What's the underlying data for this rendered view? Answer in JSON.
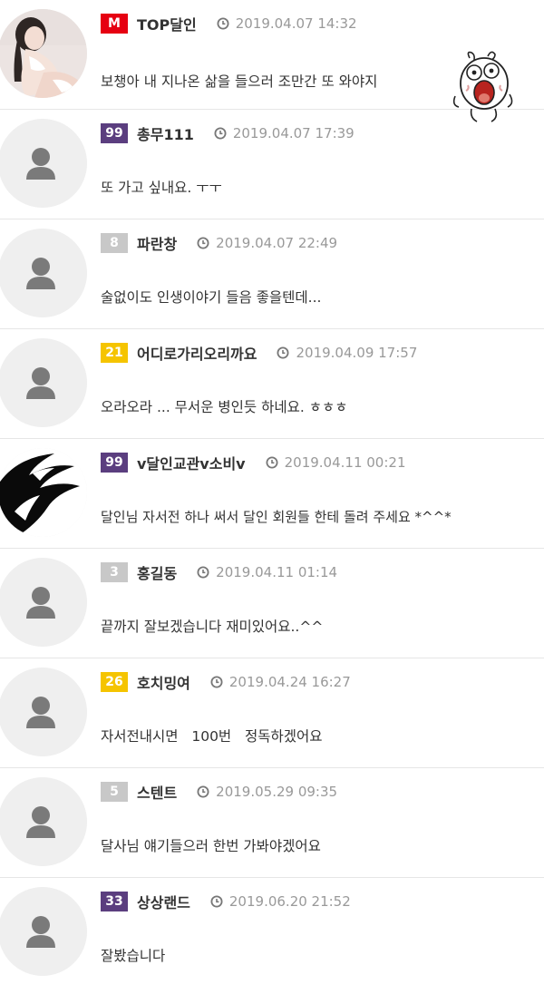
{
  "comments": [
    {
      "avatar": "user-photo",
      "level": "M",
      "level_color": "#e60012",
      "nickname": "TOP달인",
      "date": "2019.04.07 14:32",
      "content": "보챙아 내 지나온 삶을 들으러 조만간 또 와야지",
      "emoticon": "surprised-cartoon-face"
    },
    {
      "avatar": "default-person",
      "level": "99",
      "level_color": "#5b3e7f",
      "nickname": "총무111",
      "date": "2019.04.07 17:39",
      "content": "또 가고 싶내요. ㅜㅜ"
    },
    {
      "avatar": "default-person",
      "level": "8",
      "level_color": "#c8c8c8",
      "nickname": "파란창",
      "date": "2019.04.07 22:49",
      "content": "술없이도 인생이야기 들음 좋을텐데..."
    },
    {
      "avatar": "default-person",
      "level": "21",
      "level_color": "#f5c400",
      "nickname": "어디로가리오리까요",
      "date": "2019.04.09 17:57",
      "content": "오라오라 ... 무서운 병인듯 하네요. ㅎㅎㅎ"
    },
    {
      "avatar": "black-wing-image",
      "level": "99",
      "level_color": "#5b3e7f",
      "nickname": "v달인교관v소비v",
      "date": "2019.04.11 00:21",
      "content": "달인님 자서전 하나 써서 달인 회원들 한테 돌려 주세요 *^^*"
    },
    {
      "avatar": "default-person",
      "level": "3",
      "level_color": "#c8c8c8",
      "nickname": "홍길동",
      "date": "2019.04.11 01:14",
      "content": "끝까지 잘보겠습니다 재미있어요..^^"
    },
    {
      "avatar": "default-person",
      "level": "26",
      "level_color": "#f5c400",
      "nickname": "호치밍여",
      "date": "2019.04.24 16:27",
      "content": "자서전내시면   100번   정독하겠어요"
    },
    {
      "avatar": "default-person",
      "level": "5",
      "level_color": "#c8c8c8",
      "nickname": "스텐트",
      "date": "2019.05.29 09:35",
      "content": "달사님 얘기들으러 한번 가봐야겠어요"
    },
    {
      "avatar": "default-person",
      "level": "33",
      "level_color": "#5b3e7f",
      "nickname": "상상랜드",
      "date": "2019.06.20 21:52",
      "content": "잘봤습니다"
    }
  ]
}
